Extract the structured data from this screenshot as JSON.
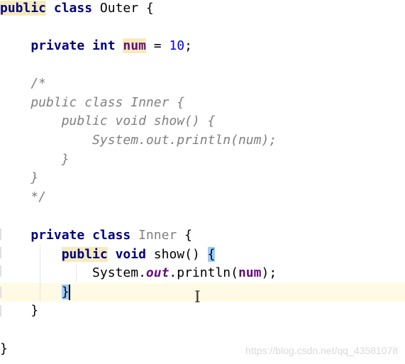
{
  "code": {
    "line1": {
      "kw1": "public",
      "kw2": "class",
      "rest": " Outer {"
    },
    "line2": {
      "indent": "    ",
      "kw1": "private",
      "kw2": "int",
      "field": "num",
      "eq": " = ",
      "num": "10",
      "end": ";"
    },
    "comment": [
      "    /*",
      "    public class Inner {",
      "        public void show() {",
      "            System.out.println(num);",
      "        }",
      "    }",
      "    */"
    ],
    "inner_decl": {
      "indent": "    ",
      "kw1": "private",
      "kw2": "class",
      "name": "Inner",
      "end": " {"
    },
    "show_decl": {
      "indent": "        ",
      "kw1": "public",
      "kw2": "void",
      "rest": " show() ",
      "brace": "{"
    },
    "println": {
      "indent": "            ",
      "pre": "System.",
      "static": "out",
      "mid": ".println(",
      "field": "num",
      "end": ");"
    },
    "close_method": {
      "indent": "        ",
      "brace": "}"
    },
    "close_inner": "    }",
    "close_outer": "}"
  },
  "watermark": "https://blog.csdn.net/qq_43581078"
}
